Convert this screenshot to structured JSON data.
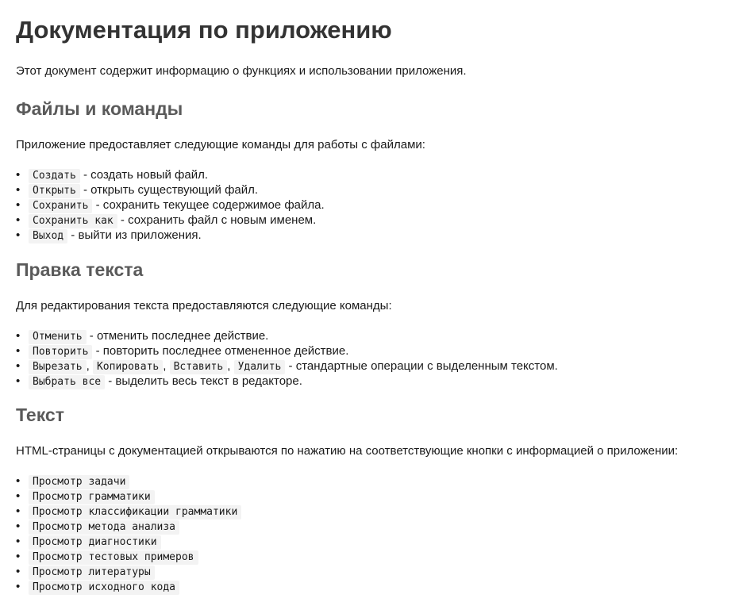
{
  "title": "Документация по приложению",
  "intro": "Этот документ содержит информацию о функциях и использовании приложения.",
  "sections": [
    {
      "heading": "Файлы и команды",
      "intro": "Приложение предоставляет следующие команды для работы с файлами:",
      "items": [
        {
          "codes": [
            "Создать"
          ],
          "text": "- создать новый файл."
        },
        {
          "codes": [
            "Открыть"
          ],
          "text": "- открыть существующий файл."
        },
        {
          "codes": [
            "Сохранить"
          ],
          "text": "- сохранить текущее содержимое файла."
        },
        {
          "codes": [
            "Сохранить как"
          ],
          "text": "- сохранить файл с новым именем."
        },
        {
          "codes": [
            "Выход"
          ],
          "text": "- выйти из приложения."
        }
      ]
    },
    {
      "heading": "Правка текста",
      "intro": "Для редактирования текста предоставляются следующие команды:",
      "items": [
        {
          "codes": [
            "Отменить"
          ],
          "text": "- отменить последнее действие."
        },
        {
          "codes": [
            "Повторить"
          ],
          "text": "- повторить последнее отмененное действие."
        },
        {
          "codes": [
            "Вырезать",
            "Копировать",
            "Вставить",
            "Удалить"
          ],
          "text": "- стандартные операции с выделенным текстом."
        },
        {
          "codes": [
            "Выбрать все"
          ],
          "text": "- выделить весь текст в редакторе."
        }
      ]
    },
    {
      "heading": "Текст",
      "intro": "HTML-страницы с документацией открываются по нажатию на соответствующие кнопки с информацией о приложении:",
      "items": [
        {
          "codes": [
            "Просмотр задачи"
          ],
          "text": ""
        },
        {
          "codes": [
            "Просмотр грамматики"
          ],
          "text": ""
        },
        {
          "codes": [
            "Просмотр классификации грамматики"
          ],
          "text": ""
        },
        {
          "codes": [
            "Просмотр метода анализа"
          ],
          "text": ""
        },
        {
          "codes": [
            "Просмотр диагностики"
          ],
          "text": ""
        },
        {
          "codes": [
            "Просмотр тестовых примеров"
          ],
          "text": ""
        },
        {
          "codes": [
            "Просмотр литературы"
          ],
          "text": ""
        },
        {
          "codes": [
            "Просмотр исходного кода"
          ],
          "text": ""
        }
      ]
    }
  ]
}
